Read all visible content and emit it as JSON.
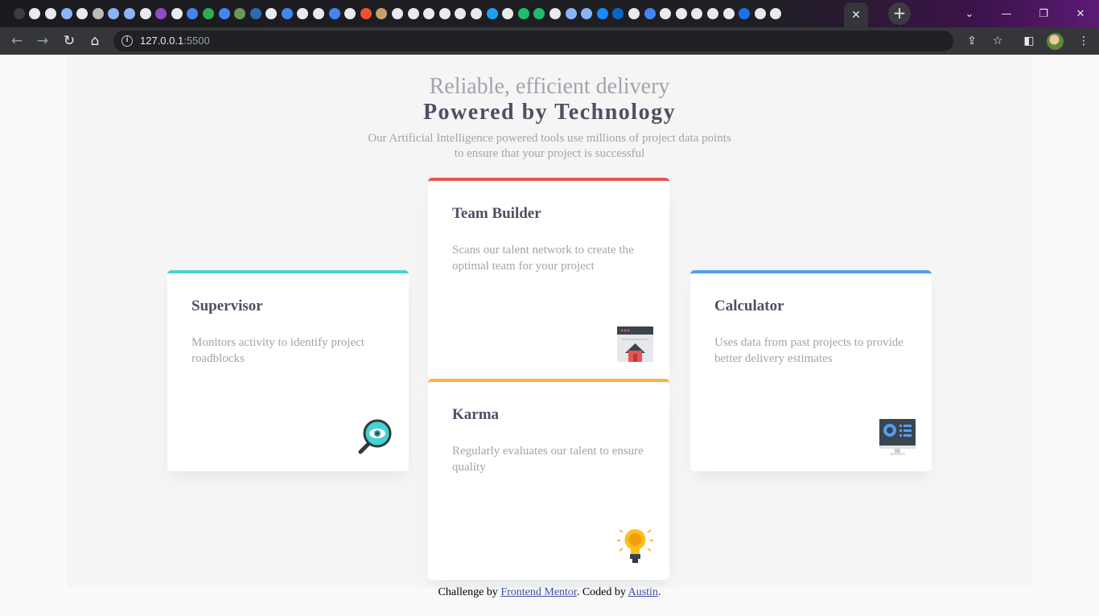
{
  "browser": {
    "url_host": "127.0.0.1",
    "url_port": ":5500",
    "new_tab_label": "+",
    "close_tab_label": "✕",
    "tab_colors": [
      "#3c3c40",
      "#e8eaed",
      "#e8eaed",
      "#8ab4f8",
      "#e8eaed",
      "#bbbbbb",
      "#8ab4f8",
      "#8ab4f8",
      "#e8eaed",
      "#8f4cc7",
      "#e8eaed",
      "#4285f4",
      "#34a853",
      "#4285f4",
      "#6a9955",
      "#2b6cb0",
      "#e8eaed",
      "#4285f4",
      "#e8eaed",
      "#e8eaed",
      "#4285f4",
      "#e8eaed",
      "#f05133",
      "#c5a26b",
      "#e8eaed",
      "#e8eaed",
      "#e8eaed",
      "#e8eaed",
      "#e8eaed",
      "#e8eaed",
      "#1da1f2",
      "#e8eaed",
      "#1fbc6d",
      "#1fbc6d",
      "#e8eaed",
      "#8ab4f8",
      "#8ab4f8",
      "#1a8cff",
      "#0a66c2",
      "#e8eaed",
      "#4285f4",
      "#e8eaed",
      "#e8eaed",
      "#e8eaed",
      "#e8eaed",
      "#e8eaed",
      "#1a73e8",
      "#e8eaed",
      "#e8eaed"
    ]
  },
  "header": {
    "subtitle": "Reliable, efficient delivery",
    "title": "Powered by Technology",
    "description": "Our Artificial Intelligence powered tools use millions of project data points to ensure that your project is successful"
  },
  "cards": {
    "supervisor": {
      "title": "Supervisor",
      "text": "Monitors activity to identify project roadblocks",
      "accent": "#44d3d2",
      "icon": "supervisor-icon"
    },
    "team_builder": {
      "title": "Team Builder",
      "text": "Scans our talent network to create the optimal team for your project",
      "accent": "#ea5454",
      "icon": "team-builder-icon"
    },
    "karma": {
      "title": "Karma",
      "text": "Regularly evaluates our talent to ensure quality",
      "accent": "#fcaf4a",
      "icon": "karma-icon"
    },
    "calculator": {
      "title": "Calculator",
      "text": "Uses data from past projects to provide better delivery estimates",
      "accent": "#549ef2",
      "icon": "calculator-icon"
    }
  },
  "footer": {
    "prefix": "Challenge by ",
    "link1": "Frontend Mentor",
    "middle": ". Coded by ",
    "link2": "Austin",
    "suffix": "."
  }
}
